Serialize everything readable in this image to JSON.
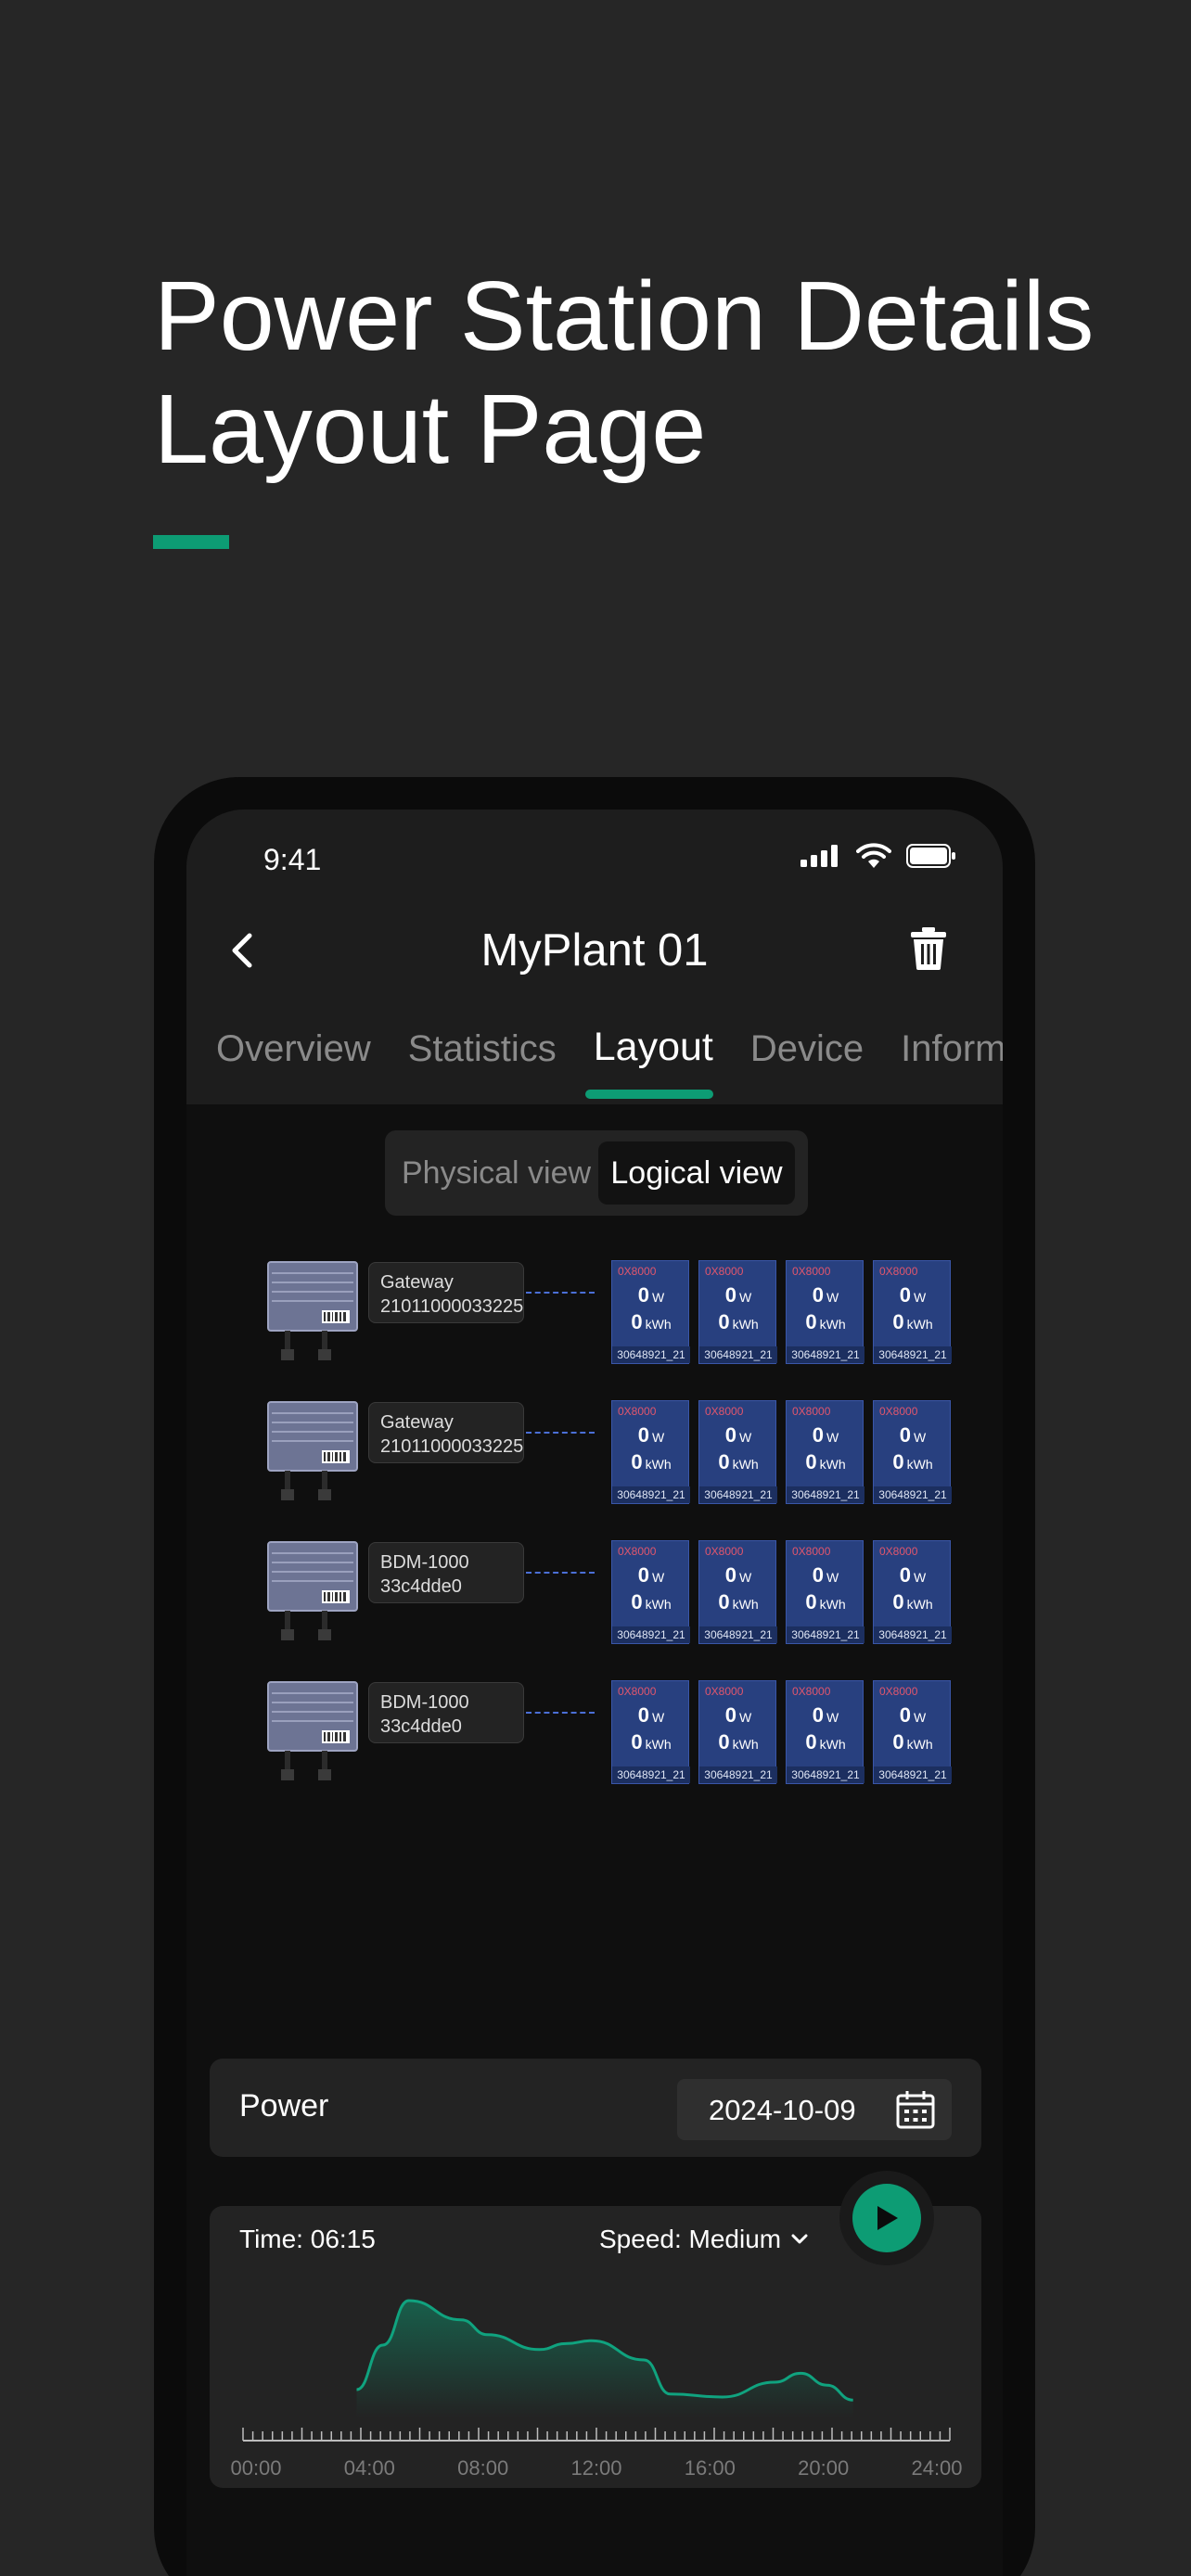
{
  "hero": {
    "title_line1": "Power Station Details",
    "title_line2": "Layout Page"
  },
  "status_bar": {
    "time": "9:41"
  },
  "nav": {
    "title": "MyPlant 01"
  },
  "tabs": [
    {
      "label": "Overview"
    },
    {
      "label": "Statistics"
    },
    {
      "label": "Layout",
      "active": true
    },
    {
      "label": "Device"
    },
    {
      "label": "Informa"
    }
  ],
  "view_toggle": {
    "physical": "Physical view",
    "logical": "Logical view",
    "selected": "Logical view"
  },
  "gateways": [
    {
      "name": "Gateway",
      "id": "21011000033225"
    },
    {
      "name": "Gateway",
      "id": "21011000033225"
    },
    {
      "name": "BDM-1000",
      "id": "33c4dde0"
    },
    {
      "name": "BDM-1000",
      "id": "33c4dde0"
    }
  ],
  "panel": {
    "id": "0X8000",
    "power": "0",
    "power_unit": "W",
    "energy": "0",
    "energy_unit": "kWh",
    "serial": "30648921_21"
  },
  "power_card": {
    "label": "Power",
    "date": "2024-10-09"
  },
  "playback": {
    "time_label": "Time: 06:15",
    "speed_label": "Speed: Medium",
    "x_ticks": [
      "00:00",
      "04:00",
      "08:00",
      "12:00",
      "16:00",
      "20:00",
      "24:00"
    ]
  },
  "chart_data": {
    "type": "area",
    "x": [
      "03:00",
      "04:00",
      "05:00",
      "07:00",
      "08:00",
      "10:00",
      "11:00",
      "12:00",
      "14:00",
      "15:00",
      "17:00",
      "19:00",
      "20:00",
      "21:00",
      "22:00"
    ],
    "values": [
      25,
      55,
      85,
      72,
      62,
      52,
      56,
      58,
      45,
      22,
      20,
      30,
      36,
      28,
      18
    ],
    "ylim": [
      0,
      100
    ],
    "colors": {
      "line": "#10a37f",
      "fill_top": "#0d9c74"
    }
  }
}
